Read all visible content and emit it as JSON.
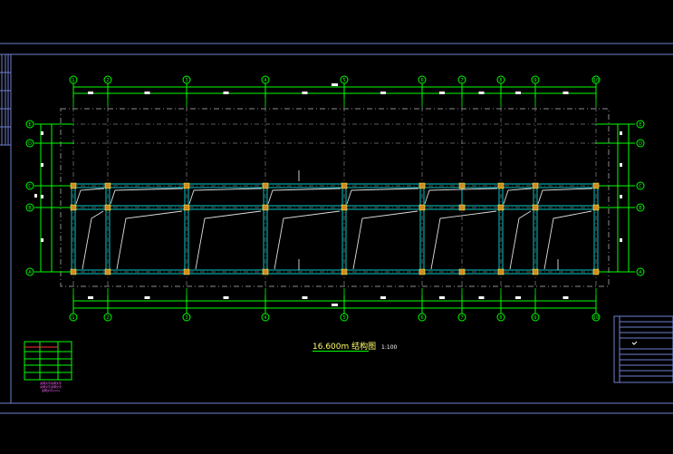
{
  "drawing": {
    "title": "16.600m",
    "title_suffix": "结构图",
    "scale": "1:100",
    "colors": {
      "background": "#000000",
      "frame": "#6f7fd0",
      "grid": "#00ff00",
      "axis_dash": "#808080",
      "beam": "#00c8c8",
      "column": "#d08a20",
      "rebar": "#e0e0e0",
      "bubble": "#00ff00"
    },
    "axes_horizontal": [
      "1",
      "2",
      "3",
      "4",
      "5",
      "6",
      "7",
      "8",
      "9",
      "10"
    ],
    "axes_vertical": [
      "E",
      "D",
      "C",
      "B",
      "A"
    ],
    "legend_lines": [
      "说明文字说明文字",
      "说明文字说明文字",
      "说明文字(mm)"
    ]
  }
}
